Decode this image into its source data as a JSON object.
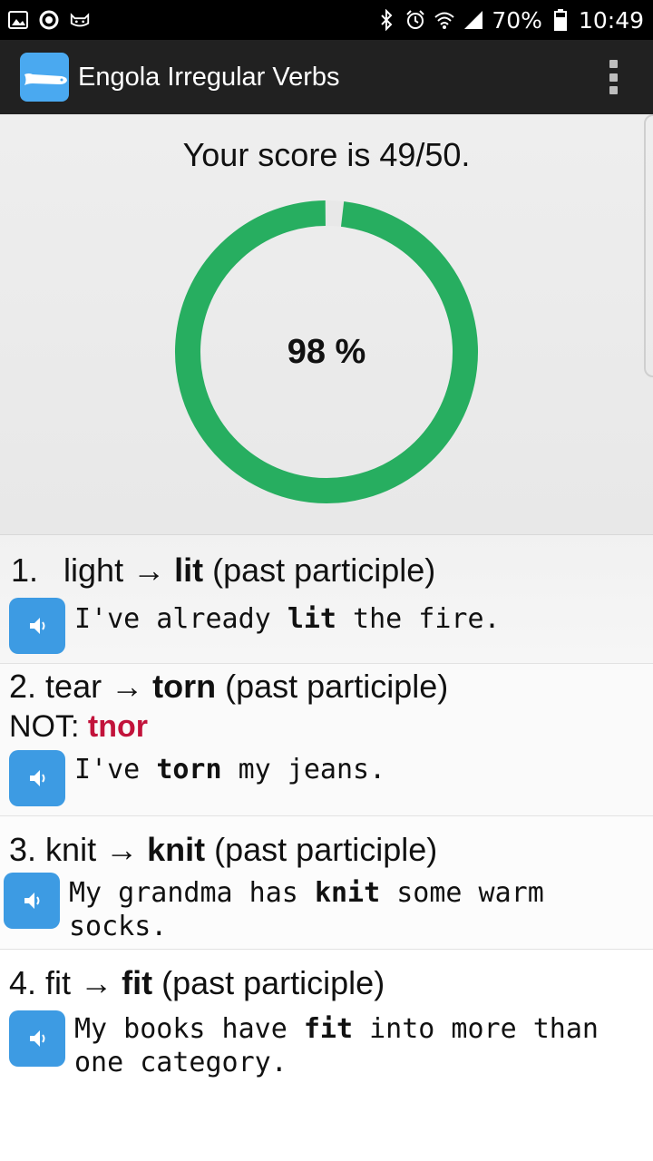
{
  "status_bar": {
    "icons_left": [
      "image-icon",
      "circle-icon",
      "cat-icon"
    ],
    "icons_right": [
      "bluetooth-icon",
      "alarm-icon",
      "wifi-icon",
      "signal-icon"
    ],
    "battery": "70%",
    "time": "10:49"
  },
  "app_bar": {
    "title": "Engola Irregular Verbs",
    "logo_icon": "fish-logo-icon",
    "menu_icon": "overflow-menu-icon"
  },
  "score": {
    "text": "Your score is 49/50.",
    "percent_label": "98 %",
    "percent_value": 98,
    "ring_color": "#27ae60",
    "ring_track_color": "#e8e8e8"
  },
  "items": [
    {
      "number": "1.",
      "base": "light",
      "arrow": "→",
      "form": "lit",
      "kind": "(past participle)",
      "example_pre": "I've already ",
      "example_bold": "lit",
      "example_post": " the fire."
    },
    {
      "number": "2.",
      "base": "tear",
      "arrow": "→",
      "form": "torn",
      "kind": "(past participle)",
      "not_label": "NOT: ",
      "wrong_answer": "tnor",
      "example_pre": "I've ",
      "example_bold": "torn",
      "example_post": " my jeans."
    },
    {
      "number": "3.",
      "base": "knit",
      "arrow": "→",
      "form": "knit",
      "kind": "(past participle)",
      "example_pre": "My grandma has ",
      "example_bold": "knit",
      "example_post": " some warm",
      "example_line2": "socks."
    },
    {
      "number": "4.",
      "base": "fit",
      "arrow": "→",
      "form": "fit",
      "kind": "(past participle)",
      "example_pre": "My books have ",
      "example_bold": "fit",
      "example_post": " into more than",
      "example_line2": "one category."
    }
  ],
  "colors": {
    "speaker_button": "#3d9be3",
    "wrong_answer": "#c2133b",
    "app_bar": "#212121"
  },
  "speaker_icon": "speaker-icon"
}
